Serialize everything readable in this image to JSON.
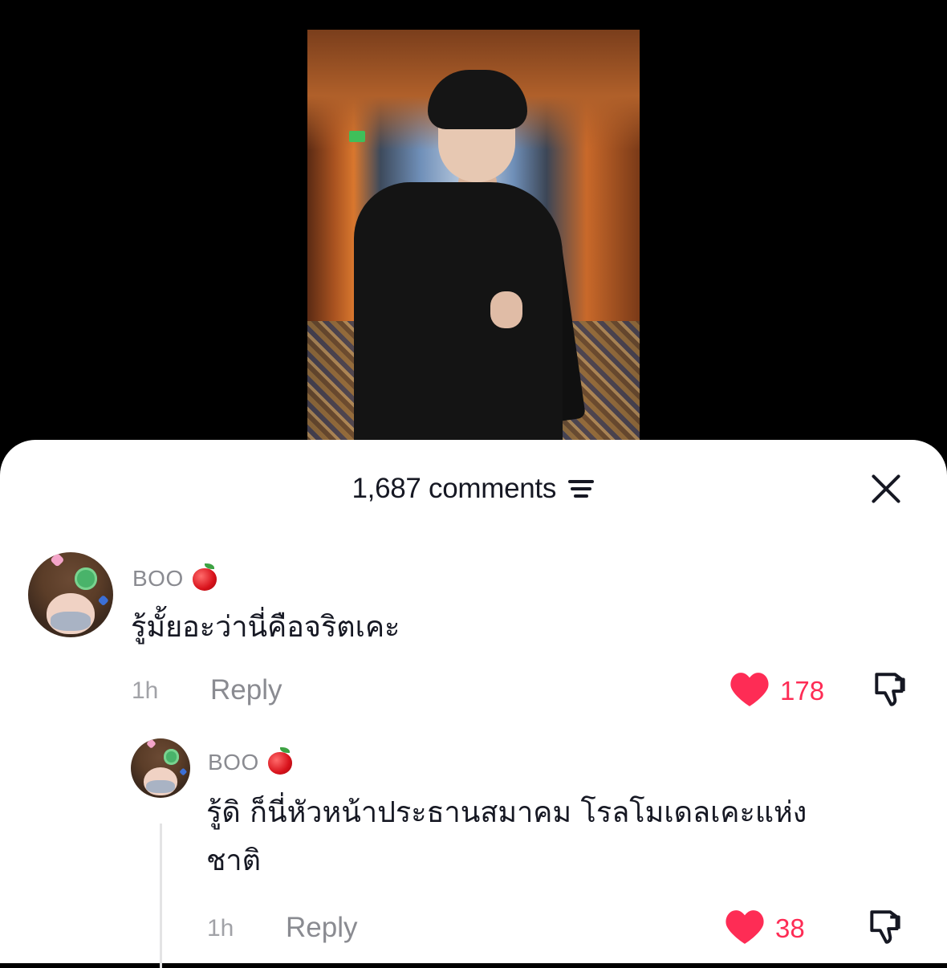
{
  "video": {
    "description_icons": [
      "exit-sign-icon"
    ]
  },
  "sheet": {
    "comment_count": "1,687 comments",
    "sort_icon": "sort-filter-icon",
    "close_icon": "close-icon"
  },
  "comments": [
    {
      "username": "BOO",
      "username_emoji": "apple-icon",
      "text": "รู้มั้ยอะว่านี่คือจริตเคะ",
      "time": "1h",
      "reply_label": "Reply",
      "likes": "178",
      "liked": true,
      "accent_color": "#fe2c55"
    },
    {
      "username": "BOO",
      "username_emoji": "apple-icon",
      "text_line1": "รู้ดิ ก็นี่หัวหน้าประธานสมาคม โรลโมเดลเคะแห่ง",
      "text_line2": "ชาติ",
      "time": "1h",
      "reply_label": "Reply",
      "likes": "38",
      "liked": true,
      "accent_color": "#fe2c55"
    }
  ]
}
